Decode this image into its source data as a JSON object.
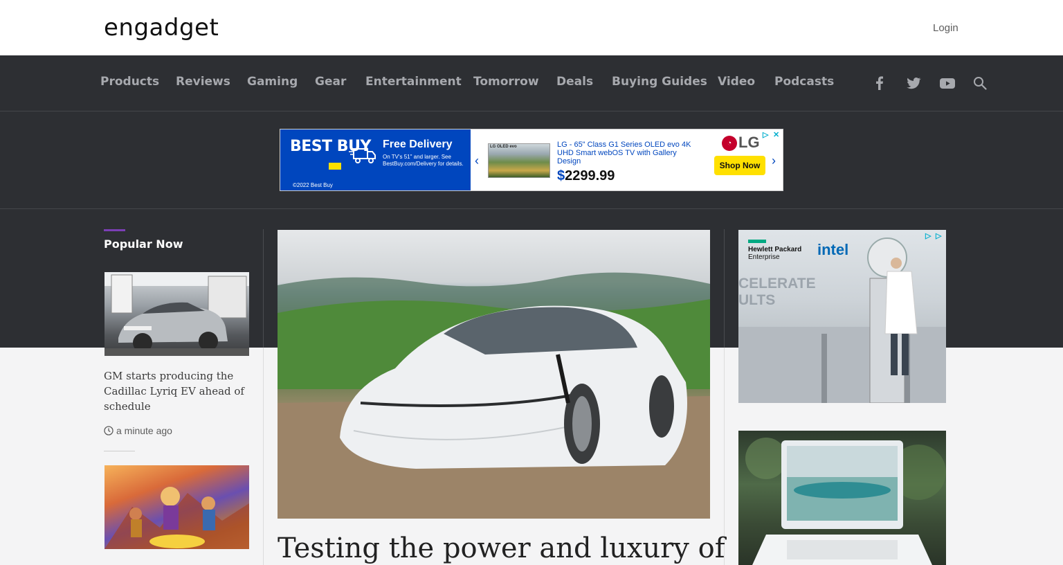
{
  "header": {
    "logo_text": "engadget",
    "login_label": "Login"
  },
  "nav": {
    "items": [
      {
        "label": "Products"
      },
      {
        "label": "Reviews"
      },
      {
        "label": "Gaming"
      },
      {
        "label": "Gear"
      },
      {
        "label": "Entertainment"
      },
      {
        "label": "Tomorrow"
      },
      {
        "label": "Deals"
      },
      {
        "label": "Buying Guides"
      },
      {
        "label": "Video"
      },
      {
        "label": "Podcasts"
      }
    ],
    "social_icons": [
      "facebook-icon",
      "twitter-icon",
      "youtube-icon",
      "search-icon"
    ]
  },
  "banner_ad": {
    "brand": "BEST BUY",
    "headline": "Free Delivery",
    "subtext": "On TV's 51\" and larger. See BestBuy.com/Delivery for details.",
    "copyright": "©2022 Best Buy",
    "thumb_label": "LG OLED evo",
    "product_desc": "LG - 65\" Class G1 Series OLED evo 4K UHD Smart webOS TV with Gallery Design",
    "price_symbol": "$",
    "price": "2299.99",
    "partner": "LG",
    "cta": "Shop Now"
  },
  "popular": {
    "heading": "Popular Now",
    "items": [
      {
        "title": "GM starts producing the Cadillac Lyriq EV ahead of schedule",
        "time": "a minute ago"
      }
    ]
  },
  "hero": {
    "title": "Testing the power and luxury of"
  },
  "side_ad": {
    "company_line1": "Hewlett Packard",
    "company_line2": "Enterprise",
    "partner": "intel",
    "faded_line1": "CELERATE",
    "faded_line2": "ULTS"
  },
  "colors": {
    "dark_bg": "#2d2f33",
    "accent_purple": "#7b3fb5",
    "bestbuy_blue": "#0046be",
    "bestbuy_yellow": "#ffe000"
  }
}
